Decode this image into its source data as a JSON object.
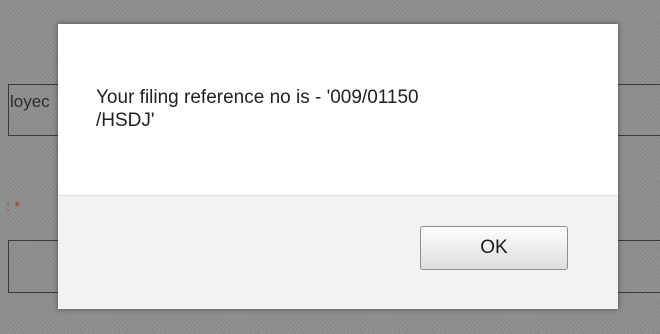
{
  "background": {
    "partial_label": "loyec",
    "required_marker": ": *"
  },
  "dialog": {
    "message_line1": "Your filing reference no is - '009/01150",
    "message_line2": "/HSDJ'",
    "ok_label": "OK"
  }
}
